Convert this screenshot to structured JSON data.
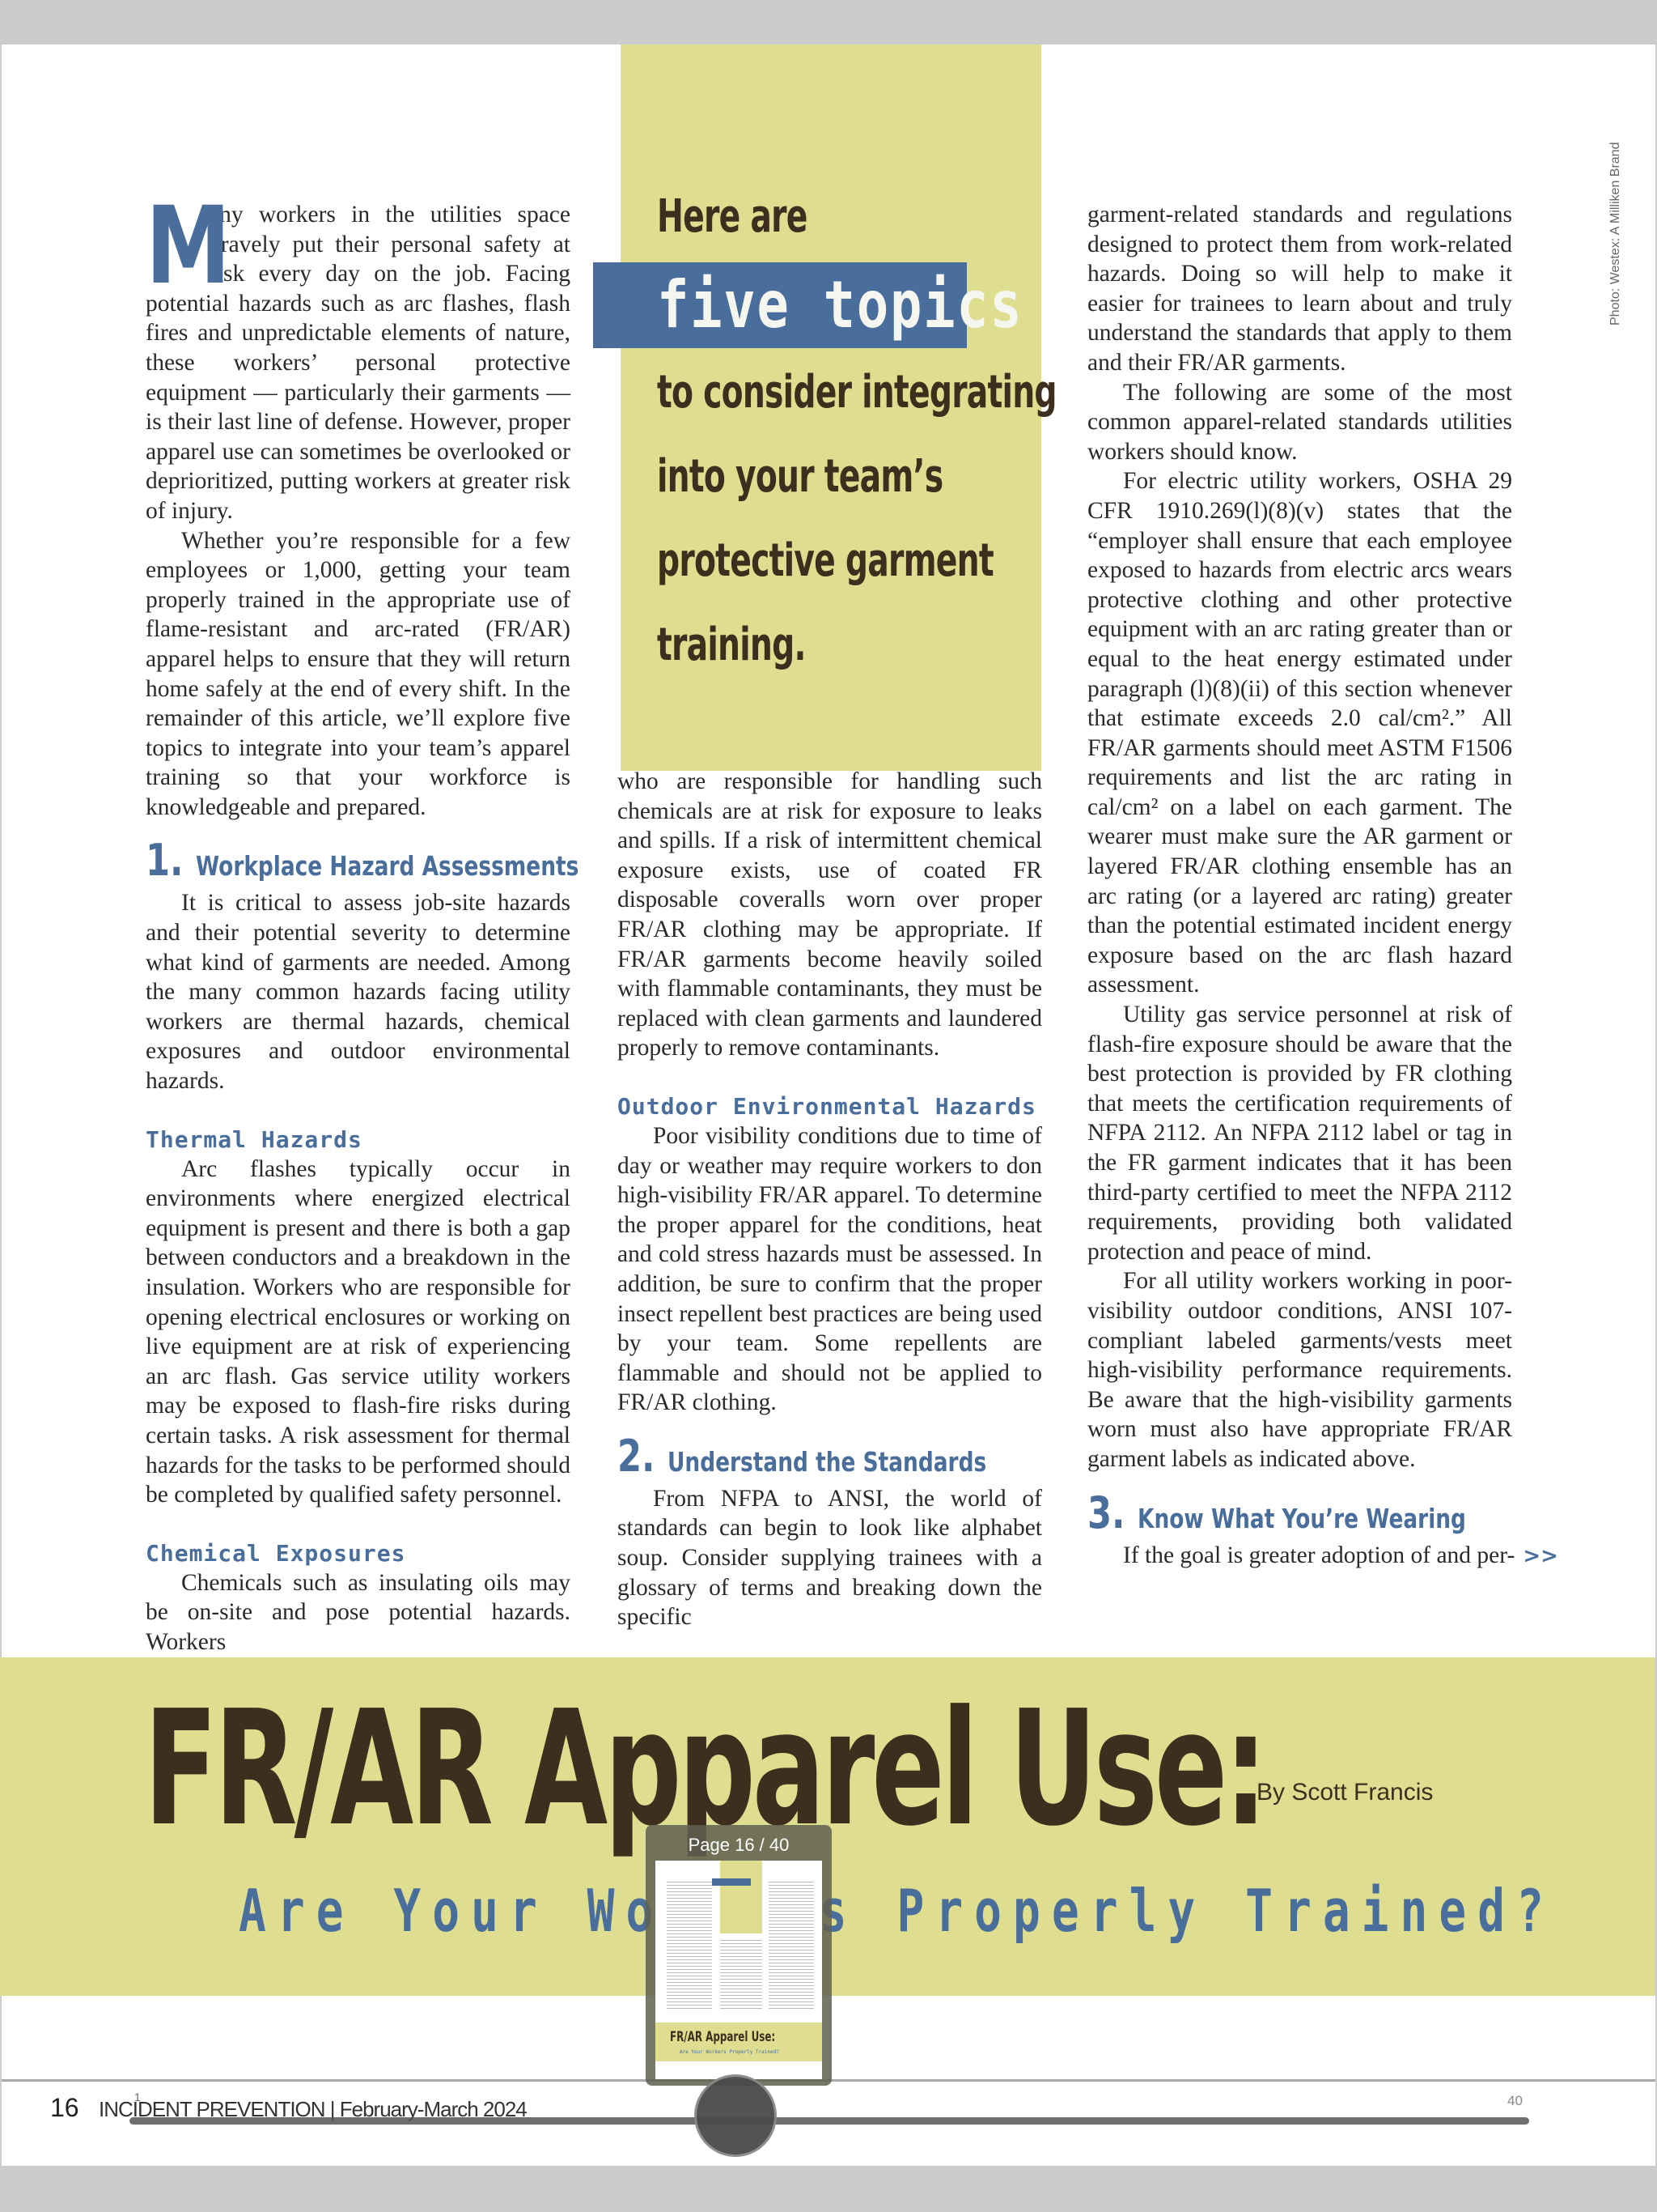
{
  "photo_credit": "Photo: Westex: A Milliken Brand",
  "pull_quote": {
    "line1": "Here are",
    "highlight": "five topics",
    "line2": "to consider integrating",
    "line3": "into your team’s",
    "line4": "protective garment",
    "line5": "training."
  },
  "article": {
    "dropcap": "M",
    "intro_p1": "any workers in the utilities space bravely put their personal safety at risk every day on the job. Facing potential hazards such as arc flashes, flash fires and unpredictable elements of nature, these workers’ personal protective equipment — particularly their garments — is their last line of defense. However, proper apparel use can sometimes be overlooked or deprioritized, putting workers at greater risk of injury.",
    "intro_p2": "Whether you’re responsible for a few employees or 1,000, getting your team properly trained in the appropriate use of flame-resistant and arc-rated (FR/AR) apparel helps to ensure that they will return home safely at the end of every shift. In the remainder of this article, we’ll explore five topics to integrate into your team’s apparel training so that your workforce is knowledgeable and prepared.",
    "section1": {
      "number": "1.",
      "heading": "Workplace Hazard Assessments",
      "p1": "It is critical to assess job-site hazards and their potential severity to determine what kind of garments are needed. Among the many common hazards facing utility workers are thermal hazards, chemical exposures and outdoor environmental hazards.",
      "thermal_heading": "Thermal Hazards",
      "thermal_p": "Arc flashes typically occur in environments where energized electrical equipment is present and there is both a gap between conductors and a breakdown in the insulation. Workers who are responsible for opening electrical enclosures or working on live equipment are at risk of experiencing an arc flash. Gas service utility workers may be exposed to flash-fire risks during certain tasks. A risk assessment for thermal hazards for the tasks to be performed should be completed by qualified safety personnel.",
      "chemical_heading": "Chemical Exposures",
      "chemical_p_start": "Chemicals such as insulating oils may be on-site and pose potential hazards. Workers",
      "chemical_p_cont": "who are responsible for handling such chemicals are at risk for exposure to leaks and spills. If a risk of intermittent chemical exposure exists, use of coated FR disposable coveralls worn over proper FR/AR clothing may be appropriate. If FR/AR garments become heavily soiled with flammable contaminants, they must be replaced with clean garments and laundered properly to remove contaminants.",
      "outdoor_heading": "Outdoor Environmental Hazards",
      "outdoor_p": "Poor visibility conditions due to time of day or weather may require workers to don high-visibility FR/AR apparel. To determine the proper apparel for the conditions, heat and cold stress hazards must be assessed. In addition, be sure to confirm that the proper insect repellent best practices are being used by your team. Some repellents are flammable and should not be applied to FR/AR clothing."
    },
    "section2": {
      "number": "2.",
      "heading": "Understand the Standards",
      "p1_start": "From NFPA to ANSI, the world of standards can begin to look like alphabet soup. Consider supplying trainees with a glossary of terms and breaking down the specific",
      "p1_cont": "garment-related standards and regulations designed to protect them from work-related hazards. Doing so will help to make it easier for trainees to learn about and truly understand the standards that apply to them and their FR/AR garments.",
      "p2": "The following are some of the most common apparel-related standards utilities workers should know.",
      "p3": "For electric utility workers, OSHA 29 CFR 1910.269(l)(8)(v) states that the “employer shall ensure that each employee exposed to hazards from electric arcs wears protective clothing and other protective equipment with an arc rating greater than or equal to the heat energy estimated under paragraph (l)(8)(ii) of this section whenever that estimate exceeds 2.0 cal/cm².” All FR/AR garments should meet ASTM F1506 requirements and list the arc rating in cal/cm² on a label on each garment. The wearer must make sure the AR garment or layered FR/AR clothing ensemble has an arc rating (or a layered arc rating) greater than the potential estimated incident energy exposure based on the arc flash hazard assessment.",
      "p4": "Utility gas service personnel at risk of flash-fire exposure should be aware that the best protection is provided by FR clothing that meets the certification requirements of NFPA 2112. An NFPA 2112 label or tag in the FR garment indicates that it has been third-party certified to meet the NFPA 2112 requirements, providing both validated protection and peace of mind.",
      "p5": "For all utility workers working in poor-visibility outdoor conditions, ANSI 107-compliant labeled garments/vests meet high-visibility performance requirements. Be aware that the high-visibility garments worn must also have appropriate FR/AR garment labels as indicated above."
    },
    "section3": {
      "number": "3.",
      "heading": "Know What You’re Wearing",
      "p1_start": "If the goal is greater adoption of and per-",
      "continue_marker": ">>"
    }
  },
  "banner": {
    "title": "FR/AR Apparel Use:",
    "byline": "By Scott Francis",
    "subtitle": "Are Your Workers Properly Trained?"
  },
  "footer": {
    "page_number": "16",
    "magazine": "INCIDENT PREVENTION | February-March 2024"
  },
  "page_slider": {
    "min_label": "1",
    "max_label": "40",
    "current_page": 16,
    "total_pages": 40,
    "preview_label": "Page 16 / 40",
    "preview_title": "FR/AR Apparel Use:",
    "preview_subtitle": "Are Your Workers Properly Trained?"
  },
  "colors": {
    "accent_blue": "#4a6e9c",
    "band_yellow": "#dfdd90",
    "title_brown": "#3e2e1e"
  }
}
